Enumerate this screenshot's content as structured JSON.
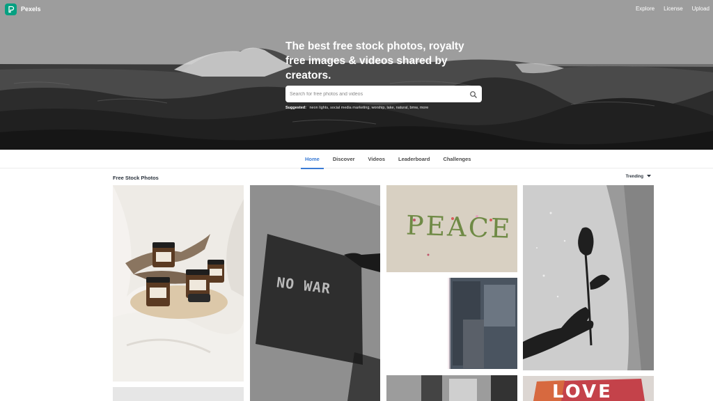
{
  "header": {
    "brand": "Pexels",
    "nav": [
      {
        "label": "Explore"
      },
      {
        "label": "License"
      },
      {
        "label": "Upload"
      }
    ]
  },
  "hero": {
    "headline": "The best free stock photos, royalty free images & videos shared by creators.",
    "search_placeholder": "Search for free photos and videos",
    "suggested_label": "Suggested:",
    "suggested": "neon lights, social media marketing, worship, lake, natural, bmw, more"
  },
  "tabs": [
    {
      "label": "Home",
      "active": true
    },
    {
      "label": "Discover",
      "active": false
    },
    {
      "label": "Videos",
      "active": false
    },
    {
      "label": "Leaderboard",
      "active": false
    },
    {
      "label": "Challenges",
      "active": false
    }
  ],
  "feed": {
    "title": "Free Stock Photos",
    "sort_label": "Trending",
    "photos": [
      {
        "text": ""
      },
      {
        "text": "NO WAR"
      },
      {
        "text": "PEACE"
      },
      {
        "text": ""
      },
      {
        "text": ""
      },
      {
        "text": ""
      },
      {
        "text": "LOVE"
      }
    ]
  },
  "colors": {
    "accent": "#05a081",
    "tab_active": "#3a7bd5"
  },
  "icons": [
    "pexels-logo-icon",
    "search-icon",
    "chevron-down-icon"
  ]
}
